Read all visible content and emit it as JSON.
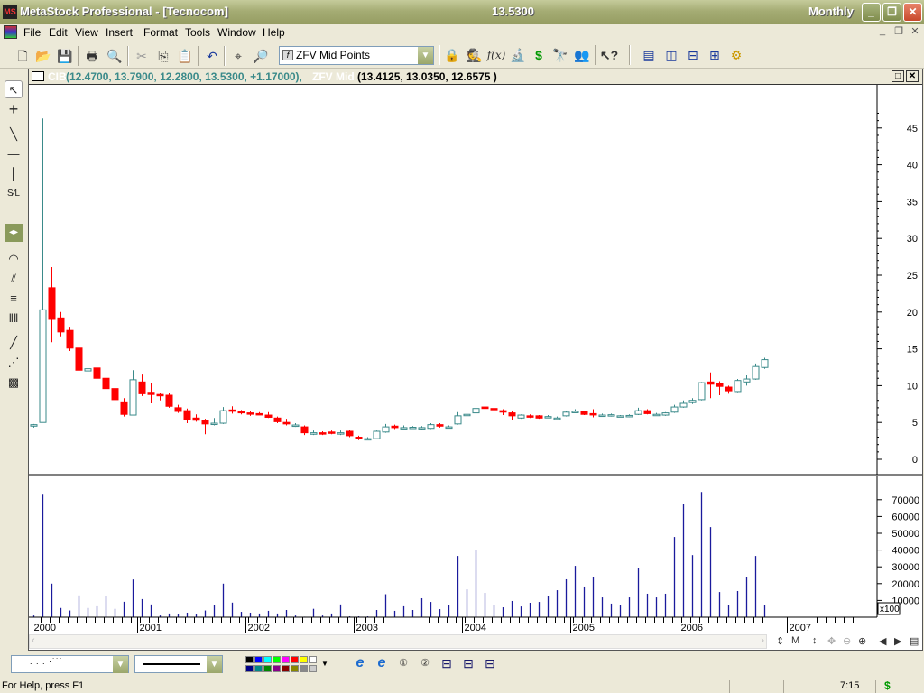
{
  "window": {
    "title": "MetaStock Professional - [Tecnocom]",
    "last_price": "13.5300",
    "periodicity": "Monthly"
  },
  "menu": [
    "File",
    "Edit",
    "View",
    "Insert",
    "Format",
    "Tools",
    "Window",
    "Help"
  ],
  "toolbar": {
    "indicator_combo": "ZFV Mid Points"
  },
  "chart_header": {
    "security": "CIB",
    "ohlc": "(12.4700, 13.7900, 12.2800, 13.5300, +1.17000),",
    "indicator": "ZFV Mid",
    "indicator_values": "(13.4125, 13.0350, 12.6575 )"
  },
  "colors": {
    "up": "#3a8a8a",
    "down": "#ff0000",
    "volume": "#1a1a9c"
  },
  "chart_data": [
    {
      "type": "candlestick",
      "title": "CIB",
      "periodicity": "Monthly",
      "yticks": [
        0,
        5,
        10,
        15,
        20,
        25,
        30,
        35,
        40,
        45
      ],
      "ylim": [
        0,
        45
      ],
      "x_labels": [
        "2000",
        "2001",
        "2002",
        "2003",
        "2004",
        "2005",
        "2006",
        "2007"
      ],
      "ohlc": [
        [
          4.5,
          4.8,
          4.3,
          4.7
        ],
        [
          5.0,
          46.3,
          5.0,
          20.3
        ],
        [
          23.3,
          26.1,
          15.9,
          19.0
        ],
        [
          19.2,
          20.0,
          16.7,
          17.3
        ],
        [
          17.5,
          18.0,
          14.7,
          15.1
        ],
        [
          15.1,
          16.2,
          11.5,
          12.1
        ],
        [
          12.0,
          12.8,
          11.8,
          12.3
        ],
        [
          12.4,
          13.1,
          10.7,
          11.0
        ],
        [
          11.0,
          13.1,
          9.2,
          9.6
        ],
        [
          9.6,
          10.4,
          7.6,
          8.1
        ],
        [
          7.8,
          8.3,
          5.8,
          6.1
        ],
        [
          6.0,
          12.1,
          6.0,
          10.8
        ],
        [
          10.5,
          11.5,
          8.6,
          8.9
        ],
        [
          9.1,
          10.4,
          7.6,
          8.8
        ],
        [
          8.8,
          9.0,
          8.0,
          8.7
        ],
        [
          8.7,
          9.0,
          7.0,
          7.2
        ],
        [
          7.0,
          7.4,
          6.3,
          6.5
        ],
        [
          6.6,
          6.9,
          4.9,
          5.4
        ],
        [
          5.6,
          6.1,
          5.1,
          5.3
        ],
        [
          5.3,
          5.5,
          3.4,
          4.8
        ],
        [
          4.8,
          5.6,
          4.6,
          4.9
        ],
        [
          4.9,
          7.1,
          4.8,
          6.6
        ],
        [
          6.7,
          7.2,
          6.2,
          6.6
        ],
        [
          6.5,
          6.7,
          6.1,
          6.3
        ],
        [
          6.3,
          6.5,
          5.9,
          6.2
        ],
        [
          6.2,
          6.4,
          6.0,
          6.1
        ],
        [
          6.0,
          6.4,
          5.6,
          5.7
        ],
        [
          5.6,
          5.8,
          4.9,
          5.1
        ],
        [
          5.0,
          5.5,
          4.6,
          4.8
        ],
        [
          4.6,
          4.9,
          4.4,
          4.65
        ],
        [
          4.4,
          4.6,
          3.3,
          3.6
        ],
        [
          3.4,
          3.9,
          3.3,
          3.6
        ],
        [
          3.6,
          3.8,
          3.3,
          3.5
        ],
        [
          3.7,
          3.9,
          3.4,
          3.6
        ],
        [
          3.5,
          3.9,
          3.3,
          3.6
        ],
        [
          3.8,
          4.0,
          3.0,
          3.2
        ],
        [
          3.0,
          3.2,
          2.6,
          2.8
        ],
        [
          2.7,
          3.0,
          2.6,
          2.8
        ],
        [
          2.8,
          3.9,
          2.7,
          3.8
        ],
        [
          3.7,
          4.8,
          3.6,
          4.4
        ],
        [
          4.5,
          4.7,
          4.1,
          4.3
        ],
        [
          4.25,
          4.6,
          4.1,
          4.3
        ],
        [
          4.35,
          4.5,
          4.1,
          4.3
        ],
        [
          4.25,
          4.5,
          4.0,
          4.3
        ],
        [
          4.2,
          4.9,
          4.1,
          4.7
        ],
        [
          4.7,
          4.9,
          4.3,
          4.5
        ],
        [
          4.35,
          4.6,
          4.2,
          4.4
        ],
        [
          4.8,
          6.4,
          4.7,
          5.9
        ],
        [
          6.0,
          6.5,
          5.9,
          6.1
        ],
        [
          6.3,
          7.5,
          6.0,
          6.9
        ],
        [
          7.1,
          7.4,
          6.8,
          6.9
        ],
        [
          6.9,
          7.2,
          6.5,
          6.8
        ],
        [
          6.6,
          6.8,
          6.0,
          6.4
        ],
        [
          6.3,
          6.5,
          5.3,
          5.9
        ],
        [
          5.6,
          6.1,
          5.5,
          6.0
        ],
        [
          5.9,
          6.1,
          5.6,
          5.8
        ],
        [
          5.9,
          6.0,
          5.5,
          5.6
        ],
        [
          5.75,
          6.0,
          5.6,
          5.8
        ],
        [
          5.55,
          5.8,
          5.4,
          5.6
        ],
        [
          5.9,
          6.5,
          5.8,
          6.4
        ],
        [
          6.45,
          6.8,
          6.3,
          6.5
        ],
        [
          6.5,
          6.6,
          6.0,
          6.1
        ],
        [
          6.2,
          6.8,
          5.7,
          6.1
        ],
        [
          5.95,
          6.2,
          5.8,
          6.0
        ],
        [
          6.05,
          6.2,
          5.8,
          6.0
        ],
        [
          5.85,
          6.0,
          5.7,
          5.9
        ],
        [
          5.9,
          6.1,
          5.7,
          5.95
        ],
        [
          6.1,
          7.0,
          6.0,
          6.6
        ],
        [
          6.6,
          6.8,
          6.1,
          6.2
        ],
        [
          6.05,
          6.3,
          5.9,
          6.1
        ],
        [
          6.0,
          6.4,
          5.9,
          6.3
        ],
        [
          6.4,
          7.4,
          6.3,
          7.1
        ],
        [
          7.1,
          8.0,
          7.0,
          7.6
        ],
        [
          7.7,
          8.3,
          7.5,
          8.0
        ],
        [
          8.1,
          10.5,
          8.0,
          10.4
        ],
        [
          10.5,
          11.8,
          8.3,
          10.2
        ],
        [
          10.3,
          10.6,
          8.7,
          9.9
        ],
        [
          9.8,
          10.0,
          8.9,
          9.3
        ],
        [
          9.2,
          10.9,
          9.1,
          10.7
        ],
        [
          10.5,
          11.4,
          10.0,
          10.9
        ],
        [
          10.9,
          13.0,
          10.8,
          12.6
        ],
        [
          12.47,
          13.79,
          12.28,
          13.53
        ]
      ]
    },
    {
      "type": "bar",
      "title": "Volume",
      "ylabel_multiplier": "x100",
      "yticks": [
        10000,
        20000,
        30000,
        40000,
        50000,
        60000,
        70000
      ],
      "ylim": [
        0,
        78000
      ],
      "values": [
        1000,
        73000,
        20000,
        5500,
        4000,
        13000,
        5500,
        6500,
        12500,
        5000,
        9200,
        22500,
        10800,
        7600,
        1000,
        2200,
        1600,
        2700,
        1600,
        4000,
        7100,
        20000,
        8700,
        3200,
        2700,
        2200,
        3800,
        2200,
        4300,
        1000,
        300,
        5000,
        1000,
        2200,
        7600,
        500,
        500,
        500,
        4300,
        13700,
        3800,
        6500,
        4300,
        11300,
        9100,
        4800,
        7000,
        36500,
        16600,
        40300,
        14500,
        7000,
        5900,
        9700,
        6400,
        8600,
        9100,
        12400,
        16100,
        22600,
        30600,
        18300,
        24200,
        11800,
        8100,
        7000,
        11800,
        29500,
        14000,
        11800,
        14000,
        47800,
        67700,
        37000,
        74600,
        53700,
        15000,
        7500,
        15600,
        24200,
        36500,
        7000
      ]
    }
  ],
  "scroll_nav": {
    "monthly_btn": "M"
  },
  "status": {
    "help": "For Help, press F1",
    "time": "7:15",
    "dollar": "$"
  }
}
